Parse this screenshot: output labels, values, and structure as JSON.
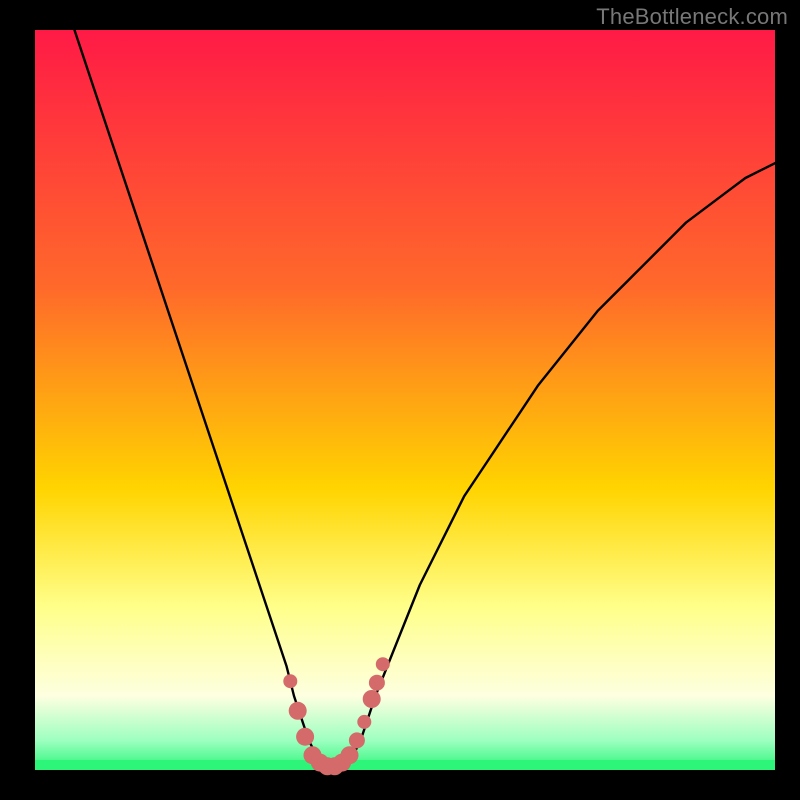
{
  "watermark": "TheBottleneck.com",
  "colors": {
    "black": "#000000",
    "gradient_top": "#ff1a46",
    "gradient_mid1": "#ff6a2a",
    "gradient_mid2": "#ffd400",
    "gradient_low": "#ffff8a",
    "gradient_pale": "#fdffe0",
    "green": "#2cf57a",
    "curve": "#000000",
    "marker_fill": "#d46a6a",
    "marker_stroke": "#b04f4f"
  },
  "chart_data": {
    "type": "line",
    "title": "",
    "xlabel": "",
    "ylabel": "",
    "xlim": [
      0,
      100
    ],
    "ylim": [
      0,
      100
    ],
    "x": [
      0,
      2,
      4,
      6,
      8,
      10,
      12,
      14,
      16,
      18,
      20,
      22,
      24,
      26,
      28,
      30,
      32,
      34,
      35,
      36,
      37,
      38,
      39,
      40,
      41,
      42,
      43,
      44,
      45,
      46,
      48,
      50,
      52,
      54,
      56,
      58,
      60,
      62,
      64,
      66,
      68,
      70,
      72,
      74,
      76,
      78,
      80,
      82,
      84,
      86,
      88,
      90,
      92,
      94,
      96,
      98,
      100
    ],
    "series": [
      {
        "name": "bottleneck_curve",
        "values": [
          115,
          110,
          104,
          98,
          92,
          86,
          80,
          74,
          68,
          62,
          56,
          50,
          44,
          38,
          32,
          26,
          20,
          14,
          10,
          7,
          4,
          2,
          1,
          0.5,
          0.5,
          1,
          2,
          4,
          7,
          10,
          15,
          20,
          25,
          29,
          33,
          37,
          40,
          43,
          46,
          49,
          52,
          54.5,
          57,
          59.5,
          62,
          64,
          66,
          68,
          70,
          72,
          74,
          75.5,
          77,
          78.5,
          80,
          81,
          82
        ]
      }
    ],
    "markers": [
      {
        "x": 34.5,
        "y": 12,
        "r": 7
      },
      {
        "x": 35.5,
        "y": 8,
        "r": 9
      },
      {
        "x": 36.5,
        "y": 4.5,
        "r": 9
      },
      {
        "x": 37.5,
        "y": 2,
        "r": 9
      },
      {
        "x": 38.5,
        "y": 1,
        "r": 9
      },
      {
        "x": 39.5,
        "y": 0.5,
        "r": 9
      },
      {
        "x": 40.5,
        "y": 0.5,
        "r": 9
      },
      {
        "x": 41.5,
        "y": 1,
        "r": 9
      },
      {
        "x": 42.5,
        "y": 2,
        "r": 9
      },
      {
        "x": 43.5,
        "y": 4,
        "r": 8
      },
      {
        "x": 44.5,
        "y": 6.5,
        "r": 7
      },
      {
        "x": 45.5,
        "y": 9.6,
        "r": 9
      },
      {
        "x": 46.2,
        "y": 11.8,
        "r": 8
      },
      {
        "x": 47.0,
        "y": 14.3,
        "r": 7
      }
    ]
  }
}
